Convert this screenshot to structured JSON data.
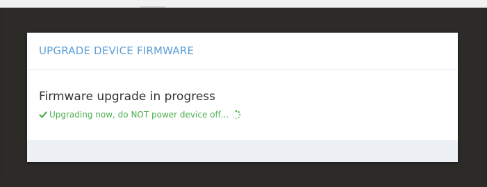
{
  "modal": {
    "title": "UPGRADE DEVICE FIRMWARE",
    "status_heading": "Firmware upgrade in progress",
    "status_message": "Upgrading now, do NOT power device off...",
    "status_icon": "check-icon",
    "progress_icon": "spinner-icon"
  },
  "colors": {
    "title": "#5b9ed6",
    "success": "#4caf50",
    "backdrop": "#2c2b28",
    "footer": "#edf1f5"
  }
}
